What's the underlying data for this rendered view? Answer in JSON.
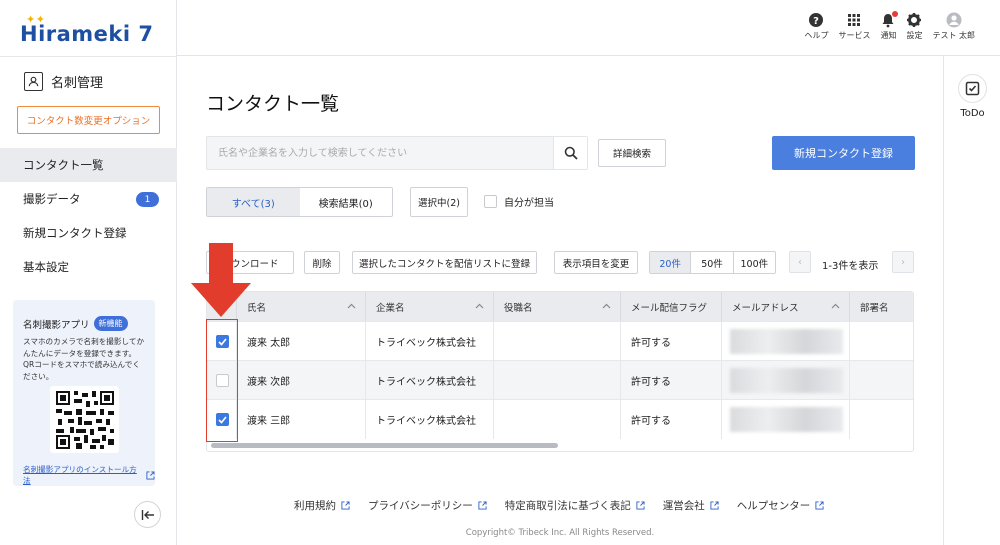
{
  "app": {
    "logo_text": "Hirameki 7"
  },
  "sidebar": {
    "section_title": "名刺管理",
    "option_button": "コンタクト数変更オプション",
    "nav": [
      {
        "label": "コンタクト一覧",
        "active": true
      },
      {
        "label": "撮影データ",
        "badge": "1"
      },
      {
        "label": "新規コンタクト登録"
      },
      {
        "label": "基本設定"
      }
    ],
    "promo": {
      "title": "名刺撮影アプリ",
      "badge": "新機能",
      "description": "スマホのカメラで名刺を撮影してかんたんにデータを登録できます。QRコードをスマホで読み込んでください。",
      "link": "名刺撮影アプリのインストール方法"
    }
  },
  "topbar": {
    "items": [
      {
        "label": "ヘルプ",
        "icon": "help-icon"
      },
      {
        "label": "サービス",
        "icon": "grid-icon"
      },
      {
        "label": "通知",
        "icon": "bell-icon"
      },
      {
        "label": "設定",
        "icon": "gear-icon"
      },
      {
        "label": "テスト 太郎",
        "icon": "user-icon"
      }
    ]
  },
  "right_panel": {
    "todo_label": "ToDo"
  },
  "main": {
    "title": "コンタクト一覧",
    "search_placeholder": "氏名や企業名を入力して検索してください",
    "advanced_search": "詳細検索",
    "new_contact": "新規コンタクト登録",
    "tabs": [
      {
        "label": "すべて(3)",
        "active": true
      },
      {
        "label": "検索結果(0)"
      }
    ],
    "selected": "選択中(2)",
    "mine_label": "自分が担当",
    "toolbar": {
      "download": "ダウンロード",
      "delete": "削除",
      "add_to_list": "選択したコンタクトを配信リストに登録",
      "change_columns": "表示項目を変更",
      "page_sizes": [
        "20件",
        "50件",
        "100件"
      ],
      "count": "1-3件を表示"
    },
    "table": {
      "headers": [
        "氏名",
        "企業名",
        "役職名",
        "メール配信フラグ",
        "メールアドレス",
        "部署名"
      ],
      "rows": [
        {
          "checked": true,
          "name": "渡来 太郎",
          "company": "トライベック株式会社",
          "title": "",
          "mail_flag": "許可する"
        },
        {
          "checked": false,
          "name": "渡来 次郎",
          "company": "トライベック株式会社",
          "title": "",
          "mail_flag": "許可する"
        },
        {
          "checked": true,
          "name": "渡来 三郎",
          "company": "トライベック株式会社",
          "title": "",
          "mail_flag": "許可する"
        }
      ]
    }
  },
  "footer": {
    "links": [
      "利用規約",
      "プライバシーポリシー",
      "特定商取引法に基づく表記",
      "運営会社",
      "ヘルプセンター"
    ],
    "copyright": "Copyright© Tribeck Inc. All Rights Reserved."
  },
  "colors": {
    "primary": "#4a7fe0",
    "annotation": "#e23c2c",
    "accent_orange": "#f08a3c"
  }
}
